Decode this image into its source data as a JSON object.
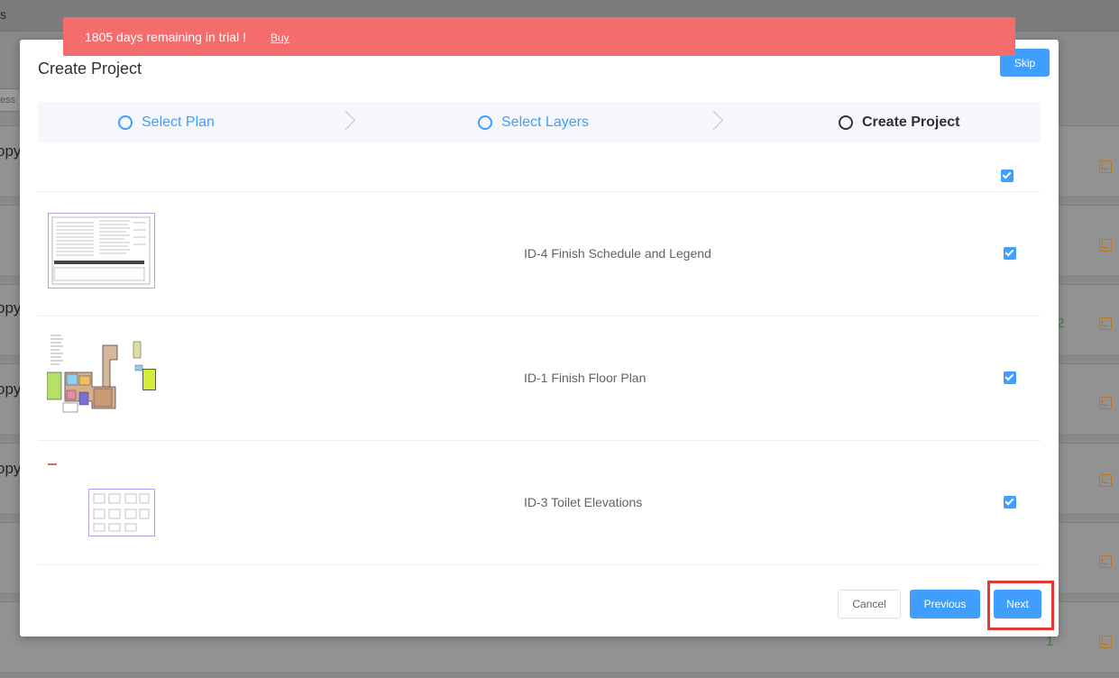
{
  "background": {
    "title_fragment": "s",
    "search_fragment": "ess",
    "card_fragments": [
      "opy",
      "",
      "opy",
      "opy",
      "opy",
      "",
      ""
    ],
    "numbers": [
      "2",
      "1"
    ]
  },
  "banner": {
    "message": "1805 days remaining in trial !",
    "buy_label": "Buy"
  },
  "modal": {
    "title": "Create Project",
    "skip_label": "Skip",
    "steps": [
      {
        "label": "Select Plan",
        "state": "done"
      },
      {
        "label": "Select Layers",
        "state": "done"
      },
      {
        "label": "Create Project",
        "state": "active"
      }
    ],
    "select_all_checked": true,
    "rows": [
      {
        "name": "ID-4 Finish Schedule and Legend",
        "checked": true,
        "thumbnail": "schedule-sheet"
      },
      {
        "name": "ID-1 Finish Floor Plan",
        "checked": true,
        "thumbnail": "floor-plan"
      },
      {
        "name": "ID-3 Toilet Elevations",
        "checked": true,
        "thumbnail": "elevations-sheet"
      }
    ],
    "buttons": {
      "cancel": "Cancel",
      "previous": "Previous",
      "next": "Next"
    }
  },
  "colors": {
    "primary": "#409eff",
    "banner": "#f56c6c",
    "highlight": "#e53935"
  }
}
